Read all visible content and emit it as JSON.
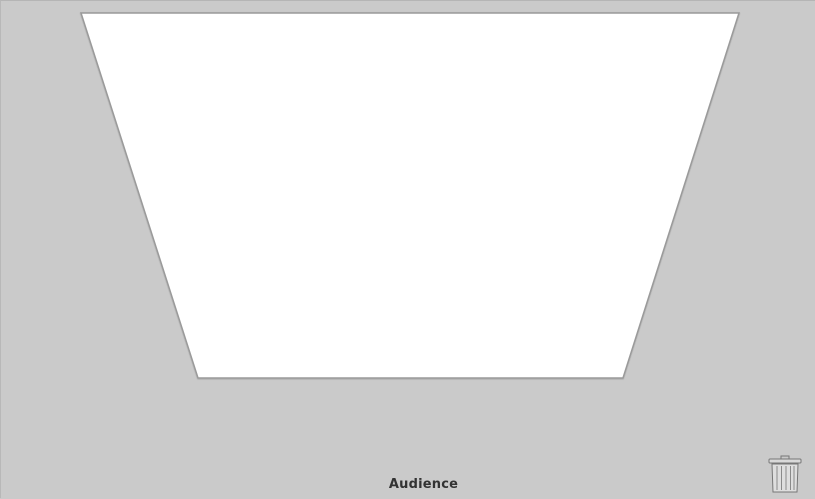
{
  "stage": {
    "shape": "trapezoid",
    "fill": "#ffffff",
    "stroke": "#9a9a9a",
    "background": "#cacaca"
  },
  "audience": {
    "label": "Audience"
  },
  "trash": {
    "icon": "trash-can-icon",
    "color": "#777777"
  }
}
